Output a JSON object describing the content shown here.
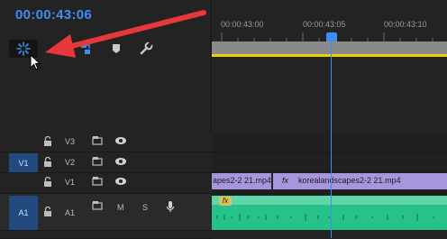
{
  "timecode": "00:00:43:06",
  "ruler": {
    "ticks": [
      "00:00:43:00",
      "00:00:43:05",
      "00:00:43:10"
    ]
  },
  "tracks": {
    "v3": {
      "name": "V3"
    },
    "v2": {
      "name": "V2",
      "target": "V1"
    },
    "v1": {
      "name": "V1"
    },
    "a1": {
      "name": "A1",
      "target": "A1",
      "mute": "M",
      "solo": "S"
    }
  },
  "clips": {
    "v1_left": {
      "label": "apes2-2 21.mp4"
    },
    "v1_right": {
      "label": "korealandscapes2-2 21.mp4",
      "fx": "fx"
    },
    "a1_left": {
      "fx": "fx"
    }
  },
  "colors": {
    "accent": "#3d8ef5",
    "video_clip": "#a796dd",
    "audio_clip": "#27c18a",
    "annotation_arrow": "#e8373a",
    "work_area": "#e8d400"
  }
}
